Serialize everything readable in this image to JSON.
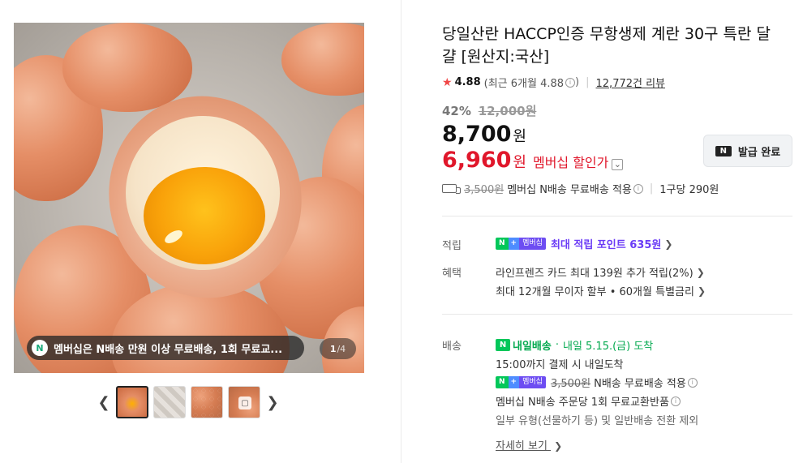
{
  "gallery": {
    "promo_text": "멤버십은 N배송 만원 이상 무료배송, 1회 무료교...",
    "n_badge": "N",
    "counter_current": "1",
    "counter_total": "/4",
    "prev_icon": "chevron-left-icon",
    "next_icon": "chevron-right-icon",
    "thumb_count": 4
  },
  "product": {
    "title": "당일산란 HACCP인증 무항생제 계란 30구 특란 달걀 [원산지:국산]",
    "rating": "4.88",
    "recent_rating": "(최근 6개월 4.88",
    "recent_close": ")",
    "review_count": "12,772건 리뷰",
    "discount_pct": "42%",
    "original_price": "12,000원",
    "price": "8,700",
    "price_unit": "원",
    "member_price": "6,960",
    "member_unit": "원",
    "member_label": "멤버십 할인가",
    "coupon_button": "발급 완료",
    "coupon_logo": "N"
  },
  "shipping_summary": {
    "strike_fee": "3,500원",
    "text": "멤버십 N배송 무료배송 적용",
    "per_unit": "1구당 290원"
  },
  "benefits": {
    "points_label": "적립",
    "points_badge_n": "N",
    "points_badge_plus": "+",
    "points_badge_m": "멤버십",
    "points_text": "최대 적립 포인트 635원",
    "benefit_label": "혜택",
    "benefit_1": "라인프렌즈 카드 최대 139원 추가 적립(2%)",
    "benefit_2": "최대 12개월 무이자 할부 • 60개월 특별금리"
  },
  "delivery": {
    "label": "배송",
    "badge": "N",
    "type": "내일배송",
    "date": "내일 5.15.(금) 도착",
    "cutoff": "15:00까지 결제 시 내일도착",
    "free_strike": "3,500원",
    "free_text": "N배송 무료배송 적용",
    "exchange": "멤버십 N배송 주문당 1회 무료교환반품",
    "exclusion": "일부 유형(선물하기 등) 및 일반배송 전환 제외",
    "detail_link": "자세히 보기"
  },
  "colors": {
    "accent_red": "#e0172b",
    "naver_green": "#03c75a",
    "points_purple": "#6b3cf6"
  }
}
